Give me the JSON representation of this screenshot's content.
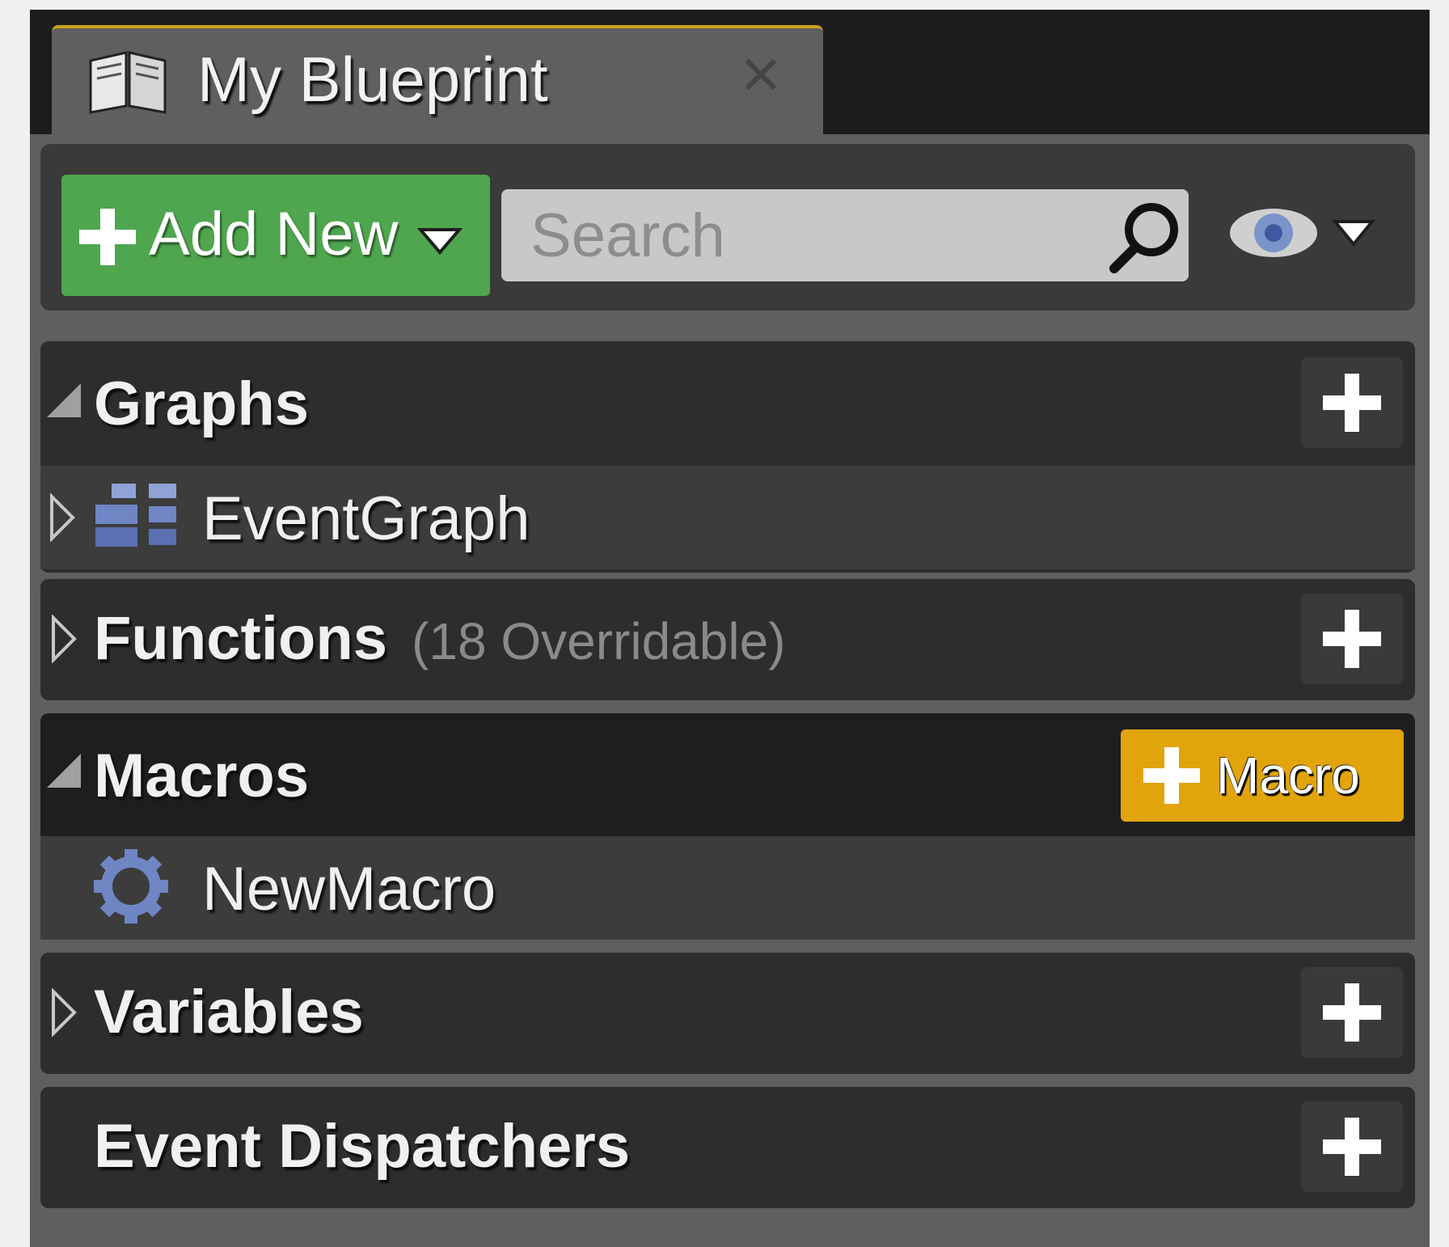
{
  "tab": {
    "title": "My Blueprint",
    "close_icon": "close-icon"
  },
  "toolbar": {
    "add_new_label": "Add New",
    "search_placeholder": "Search",
    "search_value": ""
  },
  "sections": {
    "graphs": {
      "title": "Graphs",
      "expanded": true,
      "items": [
        {
          "label": "EventGraph",
          "icon": "event-graph-icon"
        }
      ]
    },
    "functions": {
      "title": "Functions",
      "subtitle": "(18 Overridable)",
      "expanded": false
    },
    "macros": {
      "title": "Macros",
      "expanded": true,
      "add_label": "Macro",
      "items": [
        {
          "label": "NewMacro",
          "icon": "gear-icon"
        }
      ]
    },
    "variables": {
      "title": "Variables",
      "expanded": false
    },
    "event_dispatchers": {
      "title": "Event Dispatchers"
    }
  },
  "colors": {
    "add_new": "#4fa64f",
    "macro_button": "#e1a40b",
    "tab_accent": "#c8a21c",
    "icon_blue": "#6f85c4"
  }
}
